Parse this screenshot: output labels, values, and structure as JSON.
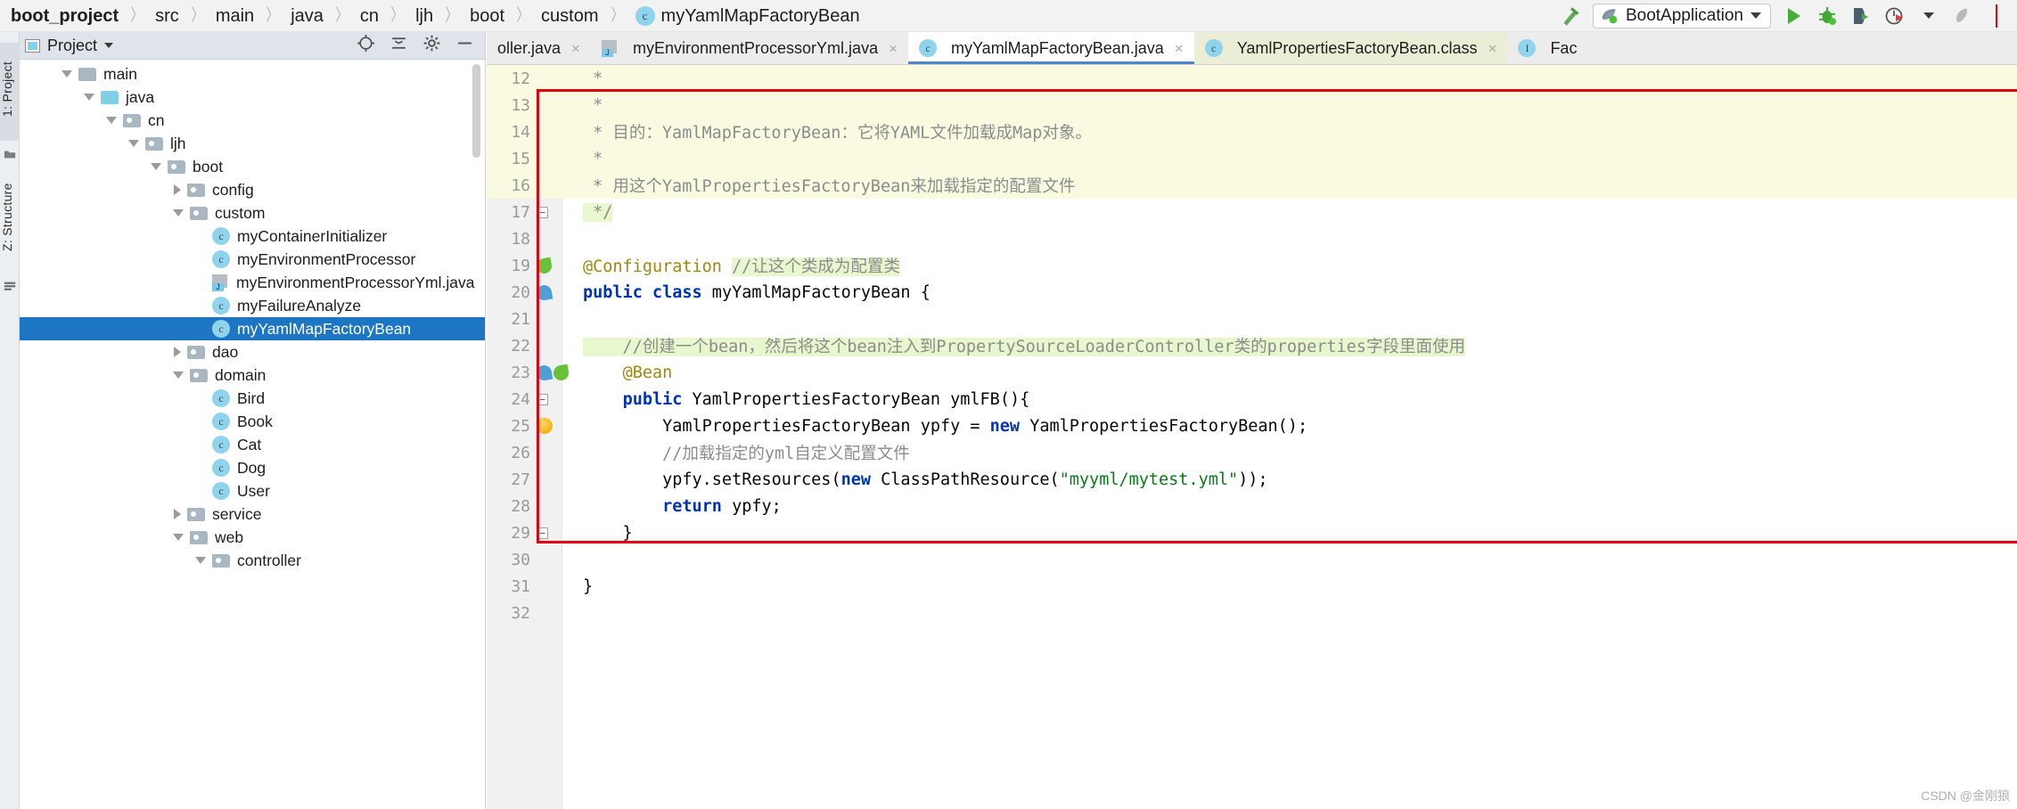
{
  "breadcrumb": {
    "items": [
      {
        "label": "boot_project",
        "bold": true,
        "icon": null
      },
      {
        "label": "src",
        "bold": false,
        "icon": null
      },
      {
        "label": "main",
        "bold": false,
        "icon": null
      },
      {
        "label": "java",
        "bold": false,
        "icon": null
      },
      {
        "label": "cn",
        "bold": false,
        "icon": null
      },
      {
        "label": "ljh",
        "bold": false,
        "icon": null
      },
      {
        "label": "boot",
        "bold": false,
        "icon": null
      },
      {
        "label": "custom",
        "bold": false,
        "icon": null
      },
      {
        "label": "myYamlMapFactoryBean",
        "bold": false,
        "icon": "class-icon"
      }
    ],
    "separator": "〉"
  },
  "toolbar": {
    "build_icon": "hammer-icon",
    "run_config_name": "BootApplication",
    "run_config_icon": "spring-boot-icon",
    "run_icon": "run-icon",
    "debug_icon": "debug-icon",
    "run_coverage_icon": "run-with-coverage-icon",
    "profiler_icon": "profiler-icon",
    "stop_icon": "stop-icon",
    "dropdown_icon": "chevron-down-icon"
  },
  "left_strip": {
    "project_label": "1: Project",
    "structure_label": "Z: Structure",
    "favorites_icon": "favorites-icon",
    "bottom_icon": "terminal-icon"
  },
  "project_panel": {
    "title": "Project",
    "title_icon": "project-view-icon",
    "dropdown_icon": "chevron-down-icon",
    "header_icons": [
      "locate-icon",
      "collapse-all-icon",
      "settings-gear-icon",
      "hide-icon"
    ],
    "tree": [
      {
        "depth": 1,
        "label": "main",
        "arrow": "down",
        "icon": "folder"
      },
      {
        "depth": 2,
        "label": "java",
        "arrow": "down",
        "icon": "folder-source"
      },
      {
        "depth": 3,
        "label": "cn",
        "arrow": "down",
        "icon": "folder-package"
      },
      {
        "depth": 4,
        "label": "ljh",
        "arrow": "down",
        "icon": "folder-package"
      },
      {
        "depth": 5,
        "label": "boot",
        "arrow": "down",
        "icon": "folder-package"
      },
      {
        "depth": 6,
        "label": "config",
        "arrow": "right",
        "icon": "folder-package"
      },
      {
        "depth": 6,
        "label": "custom",
        "arrow": "down",
        "icon": "folder-package"
      },
      {
        "depth": 7,
        "label": "myContainerInitializer",
        "arrow": "none",
        "icon": "class"
      },
      {
        "depth": 7,
        "label": "myEnvironmentProcessor",
        "arrow": "none",
        "icon": "class"
      },
      {
        "depth": 7,
        "label": "myEnvironmentProcessorYml.java",
        "arrow": "none",
        "icon": "java-file"
      },
      {
        "depth": 7,
        "label": "myFailureAnalyze",
        "arrow": "none",
        "icon": "class"
      },
      {
        "depth": 7,
        "label": "myYamlMapFactoryBean",
        "arrow": "none",
        "icon": "class",
        "selected": true
      },
      {
        "depth": 6,
        "label": "dao",
        "arrow": "right",
        "icon": "folder-package"
      },
      {
        "depth": 6,
        "label": "domain",
        "arrow": "down",
        "icon": "folder-package"
      },
      {
        "depth": 7,
        "label": "Bird",
        "arrow": "none",
        "icon": "class"
      },
      {
        "depth": 7,
        "label": "Book",
        "arrow": "none",
        "icon": "class"
      },
      {
        "depth": 7,
        "label": "Cat",
        "arrow": "none",
        "icon": "class"
      },
      {
        "depth": 7,
        "label": "Dog",
        "arrow": "none",
        "icon": "class"
      },
      {
        "depth": 7,
        "label": "User",
        "arrow": "none",
        "icon": "class"
      },
      {
        "depth": 6,
        "label": "service",
        "arrow": "right",
        "icon": "folder-package"
      },
      {
        "depth": 6,
        "label": "web",
        "arrow": "down",
        "icon": "folder-package"
      },
      {
        "depth": 7,
        "label": "controller",
        "arrow": "down",
        "icon": "folder-package"
      }
    ]
  },
  "editor_tabs": [
    {
      "label": "oller.java",
      "icon": null,
      "active": false,
      "style": "normal",
      "close": "×"
    },
    {
      "label": "myEnvironmentProcessorYml.java",
      "icon": "java-file-icon",
      "active": false,
      "style": "normal",
      "close": "×"
    },
    {
      "label": "myYamlMapFactoryBean.java",
      "icon": "class-icon",
      "active": true,
      "style": "active",
      "close": "×"
    },
    {
      "label": "YamlPropertiesFactoryBean.class",
      "icon": "class-locked-icon",
      "active": false,
      "style": "yellow",
      "close": "×"
    },
    {
      "label": "Fac",
      "icon": "interface-icon",
      "active": false,
      "style": "normal",
      "close": ""
    }
  ],
  "code": {
    "lines": [
      {
        "num": "12",
        "gutter": "",
        "highlight": true,
        "tokens": [
          {
            "t": " * ",
            "c": "cmt"
          }
        ]
      },
      {
        "num": "13",
        "gutter": "",
        "highlight": true,
        "tokens": [
          {
            "t": " * ",
            "c": "cmt"
          }
        ]
      },
      {
        "num": "14",
        "gutter": "",
        "highlight": true,
        "tokens": [
          {
            "t": " * 目的：YamlMapFactoryBean：它将YAML文件加载成Map对象。",
            "c": "cmt"
          }
        ]
      },
      {
        "num": "15",
        "gutter": "",
        "highlight": true,
        "tokens": [
          {
            "t": " * ",
            "c": "cmt"
          }
        ]
      },
      {
        "num": "16",
        "gutter": "",
        "highlight": true,
        "tokens": [
          {
            "t": " * 用这个YamlPropertiesFactoryBean来加载指定的配置文件",
            "c": "cmt"
          }
        ]
      },
      {
        "num": "17",
        "gutter": "fold",
        "highlight": false,
        "tokens": [
          {
            "t": " */",
            "c": "cmt",
            "bg": true
          }
        ]
      },
      {
        "num": "18",
        "gutter": "",
        "highlight": false,
        "tokens": [
          {
            "t": "",
            "c": "txt"
          }
        ]
      },
      {
        "num": "19",
        "gutter": "leaf-check",
        "highlight": false,
        "tokens": [
          {
            "t": "@Configuration",
            "c": "ann"
          },
          {
            "t": " ",
            "c": "txt"
          },
          {
            "t": "//让这个类成为配置类",
            "c": "cmt",
            "bg": true
          }
        ]
      },
      {
        "num": "20",
        "gutter": "leaf-bean",
        "highlight": false,
        "tokens": [
          {
            "t": "public",
            "c": "kw"
          },
          {
            "t": " ",
            "c": "txt"
          },
          {
            "t": "class",
            "c": "kw"
          },
          {
            "t": " myYamlMapFactoryBean {",
            "c": "txt"
          }
        ]
      },
      {
        "num": "21",
        "gutter": "",
        "highlight": false,
        "tokens": [
          {
            "t": "",
            "c": "txt"
          }
        ]
      },
      {
        "num": "22",
        "gutter": "",
        "highlight": false,
        "tokens": [
          {
            "t": "    //创建一个bean，然后将这个bean注入到PropertySourceLoaderController类的properties字段里面使用",
            "c": "cmt",
            "bg": true
          }
        ]
      },
      {
        "num": "23",
        "gutter": "bean-leaf-check",
        "highlight": false,
        "tokens": [
          {
            "t": "    ",
            "c": "txt"
          },
          {
            "t": "@Bean",
            "c": "ann"
          }
        ]
      },
      {
        "num": "24",
        "gutter": "fold",
        "highlight": false,
        "tokens": [
          {
            "t": "    ",
            "c": "txt"
          },
          {
            "t": "public",
            "c": "kw"
          },
          {
            "t": " YamlPropertiesFactoryBean ",
            "c": "txt"
          },
          {
            "t": "ymlFB",
            "c": "txt"
          },
          {
            "t": "(){",
            "c": "txt"
          }
        ]
      },
      {
        "num": "25",
        "gutter": "bulb",
        "highlight": false,
        "tokens": [
          {
            "t": "        YamlPropertiesFactoryBean ypfy = ",
            "c": "txt"
          },
          {
            "t": "new",
            "c": "kw"
          },
          {
            "t": " YamlPropertiesFactoryBean();",
            "c": "txt"
          }
        ]
      },
      {
        "num": "26",
        "gutter": "",
        "highlight": false,
        "tokens": [
          {
            "t": "        //加载指定的yml自定义配置文件",
            "c": "cmt"
          }
        ]
      },
      {
        "num": "27",
        "gutter": "",
        "highlight": false,
        "tokens": [
          {
            "t": "        ypfy.setResources(",
            "c": "txt"
          },
          {
            "t": "new",
            "c": "kw"
          },
          {
            "t": " ClassPathResource(",
            "c": "txt"
          },
          {
            "t": "\"myyml/mytest.yml\"",
            "c": "str"
          },
          {
            "t": "));",
            "c": "txt"
          }
        ]
      },
      {
        "num": "28",
        "gutter": "",
        "highlight": false,
        "tokens": [
          {
            "t": "        ",
            "c": "txt"
          },
          {
            "t": "return",
            "c": "kw"
          },
          {
            "t": " ypfy;",
            "c": "txt"
          }
        ]
      },
      {
        "num": "29",
        "gutter": "fold",
        "highlight": false,
        "tokens": [
          {
            "t": "    }",
            "c": "txt"
          }
        ]
      },
      {
        "num": "30",
        "gutter": "",
        "highlight": false,
        "tokens": [
          {
            "t": "",
            "c": "txt"
          }
        ]
      },
      {
        "num": "31",
        "gutter": "",
        "highlight": false,
        "tokens": [
          {
            "t": "}",
            "c": "txt"
          }
        ]
      },
      {
        "num": "32",
        "gutter": "",
        "highlight": false,
        "tokens": [
          {
            "t": "",
            "c": "txt"
          }
        ]
      }
    ]
  },
  "annotation": {
    "red_box_name": "red-highlight-rectangle",
    "color": "#e3000f"
  },
  "watermark": "CSDN @金刚狼",
  "colors": {
    "accent": "#1d76c4",
    "comment_green_bg": "#e8f7cd",
    "highlight_yellow": "#fafae0",
    "annotation_red": "#e3000f",
    "keyword_blue": "#0033b3",
    "string_green": "#067d17",
    "annotation_gold": "#9e880d"
  }
}
